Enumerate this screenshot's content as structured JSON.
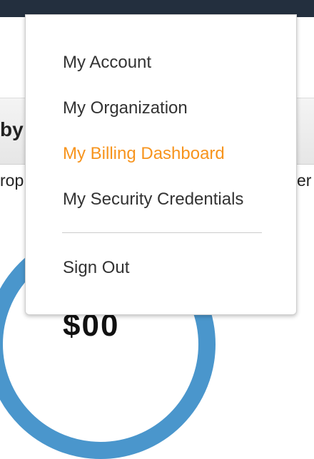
{
  "background": {
    "band_text": "by",
    "left_fragment": "rop",
    "right_fragment": "er",
    "amount_fragment": "$00",
    "donut_color": "#4a96cc",
    "topbar_color": "#232f3e"
  },
  "menu": {
    "items": [
      {
        "label": "My Account"
      },
      {
        "label": "My Organization"
      },
      {
        "label": "My Billing Dashboard",
        "highlighted": true
      },
      {
        "label": "My Security Credentials"
      }
    ],
    "sign_out": "Sign Out",
    "text_color": "#333333",
    "highlight_color": "#f7941d"
  }
}
